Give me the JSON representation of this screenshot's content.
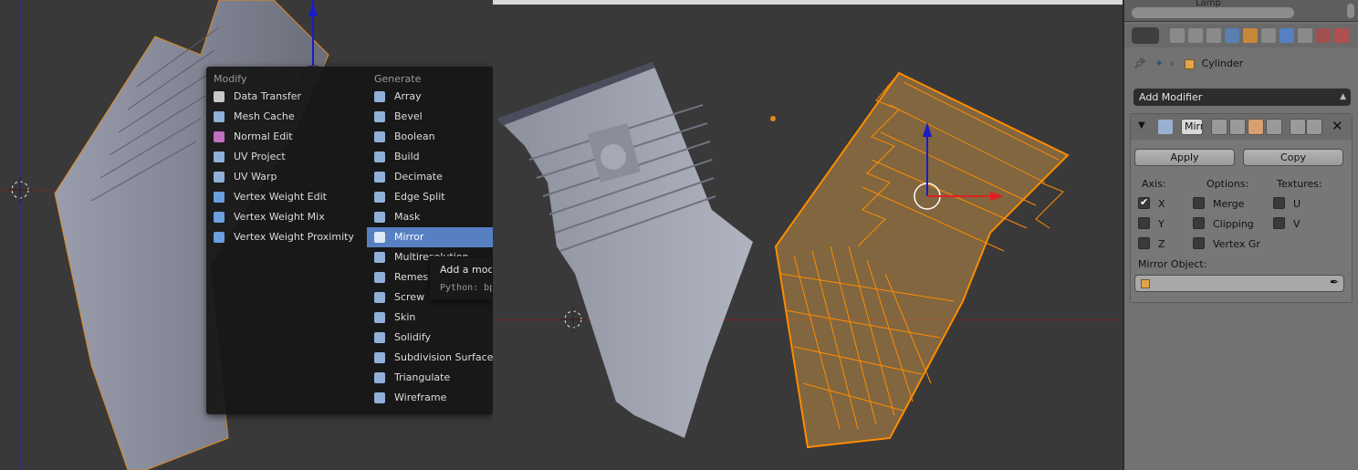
{
  "menu": {
    "modify_heading": "Modify",
    "generate_heading": "Generate",
    "modify_items": [
      {
        "label": "Data Transfer",
        "icon": "data-transfer-icon",
        "color": "#c8c8c8"
      },
      {
        "label": "Mesh Cache",
        "icon": "mesh-cache-icon",
        "color": "#8fb0d8"
      },
      {
        "label": "Normal Edit",
        "icon": "normal-edit-icon",
        "color": "#c070c0"
      },
      {
        "label": "UV Project",
        "icon": "uv-project-icon",
        "color": "#8fb0d8"
      },
      {
        "label": "UV Warp",
        "icon": "uv-warp-icon",
        "color": "#8fb0d8"
      },
      {
        "label": "Vertex Weight Edit",
        "icon": "vertex-weight-edit-icon",
        "color": "#6aa0e0"
      },
      {
        "label": "Vertex Weight Mix",
        "icon": "vertex-weight-mix-icon",
        "color": "#6aa0e0"
      },
      {
        "label": "Vertex Weight Proximity",
        "icon": "vertex-weight-proximity-icon",
        "color": "#6aa0e0"
      }
    ],
    "generate_items": [
      {
        "label": "Array",
        "icon": "array-icon",
        "color": "#8fb0d8"
      },
      {
        "label": "Bevel",
        "icon": "bevel-icon",
        "color": "#8fb0d8"
      },
      {
        "label": "Boolean",
        "icon": "boolean-icon",
        "color": "#8fb0d8"
      },
      {
        "label": "Build",
        "icon": "build-icon",
        "color": "#8fb0d8"
      },
      {
        "label": "Decimate",
        "icon": "decimate-icon",
        "color": "#8fb0d8"
      },
      {
        "label": "Edge Split",
        "icon": "edge-split-icon",
        "color": "#8fb0d8"
      },
      {
        "label": "Mask",
        "icon": "mask-icon",
        "color": "#8fb0d8"
      },
      {
        "label": "Mirror",
        "icon": "mirror-icon",
        "color": "#dfe8f5",
        "active": true
      },
      {
        "label": "Multiresolution",
        "icon": "multires-icon",
        "color": "#8fb0d8"
      },
      {
        "label": "Remesh",
        "icon": "remesh-icon",
        "color": "#8fb0d8"
      },
      {
        "label": "Screw",
        "icon": "screw-icon",
        "color": "#8fb0d8"
      },
      {
        "label": "Skin",
        "icon": "skin-icon",
        "color": "#8fb0d8"
      },
      {
        "label": "Solidify",
        "icon": "solidify-icon",
        "color": "#8fb0d8"
      },
      {
        "label": "Subdivision Surface",
        "icon": "subsurf-icon",
        "color": "#8fb0d8"
      },
      {
        "label": "Triangulate",
        "icon": "triangulate-icon",
        "color": "#8fb0d8"
      },
      {
        "label": "Wireframe",
        "icon": "wireframe-icon",
        "color": "#8fb0d8"
      }
    ]
  },
  "tooltip": {
    "title": "Add a modifier",
    "python": "Python: bpy.ops.object.modifier_add()"
  },
  "properties": {
    "outliner_lamp": "Lamp",
    "context_object": "Cylinder",
    "add_modifier_label": "Add Modifier",
    "modifier": {
      "name": "Mirror",
      "apply_label": "Apply",
      "copy_label": "Copy",
      "axis_label": "Axis:",
      "options_label": "Options:",
      "textures_label": "Textures:",
      "axes": [
        {
          "label": "X",
          "checked": true
        },
        {
          "label": "Y",
          "checked": false
        },
        {
          "label": "Z",
          "checked": false
        }
      ],
      "options": [
        {
          "label": "Merge",
          "checked": false
        },
        {
          "label": "Clipping",
          "checked": false
        },
        {
          "label": "Vertex Gr",
          "checked": false
        }
      ],
      "textures": [
        {
          "label": "U",
          "checked": false
        },
        {
          "label": "V",
          "checked": false
        }
      ],
      "mirror_object_label": "Mirror Object:",
      "mirror_object_value": ""
    }
  },
  "colors": {
    "selection": "#ff8c00",
    "active_item": "#5680c2",
    "viewport_bg": "#393939"
  }
}
